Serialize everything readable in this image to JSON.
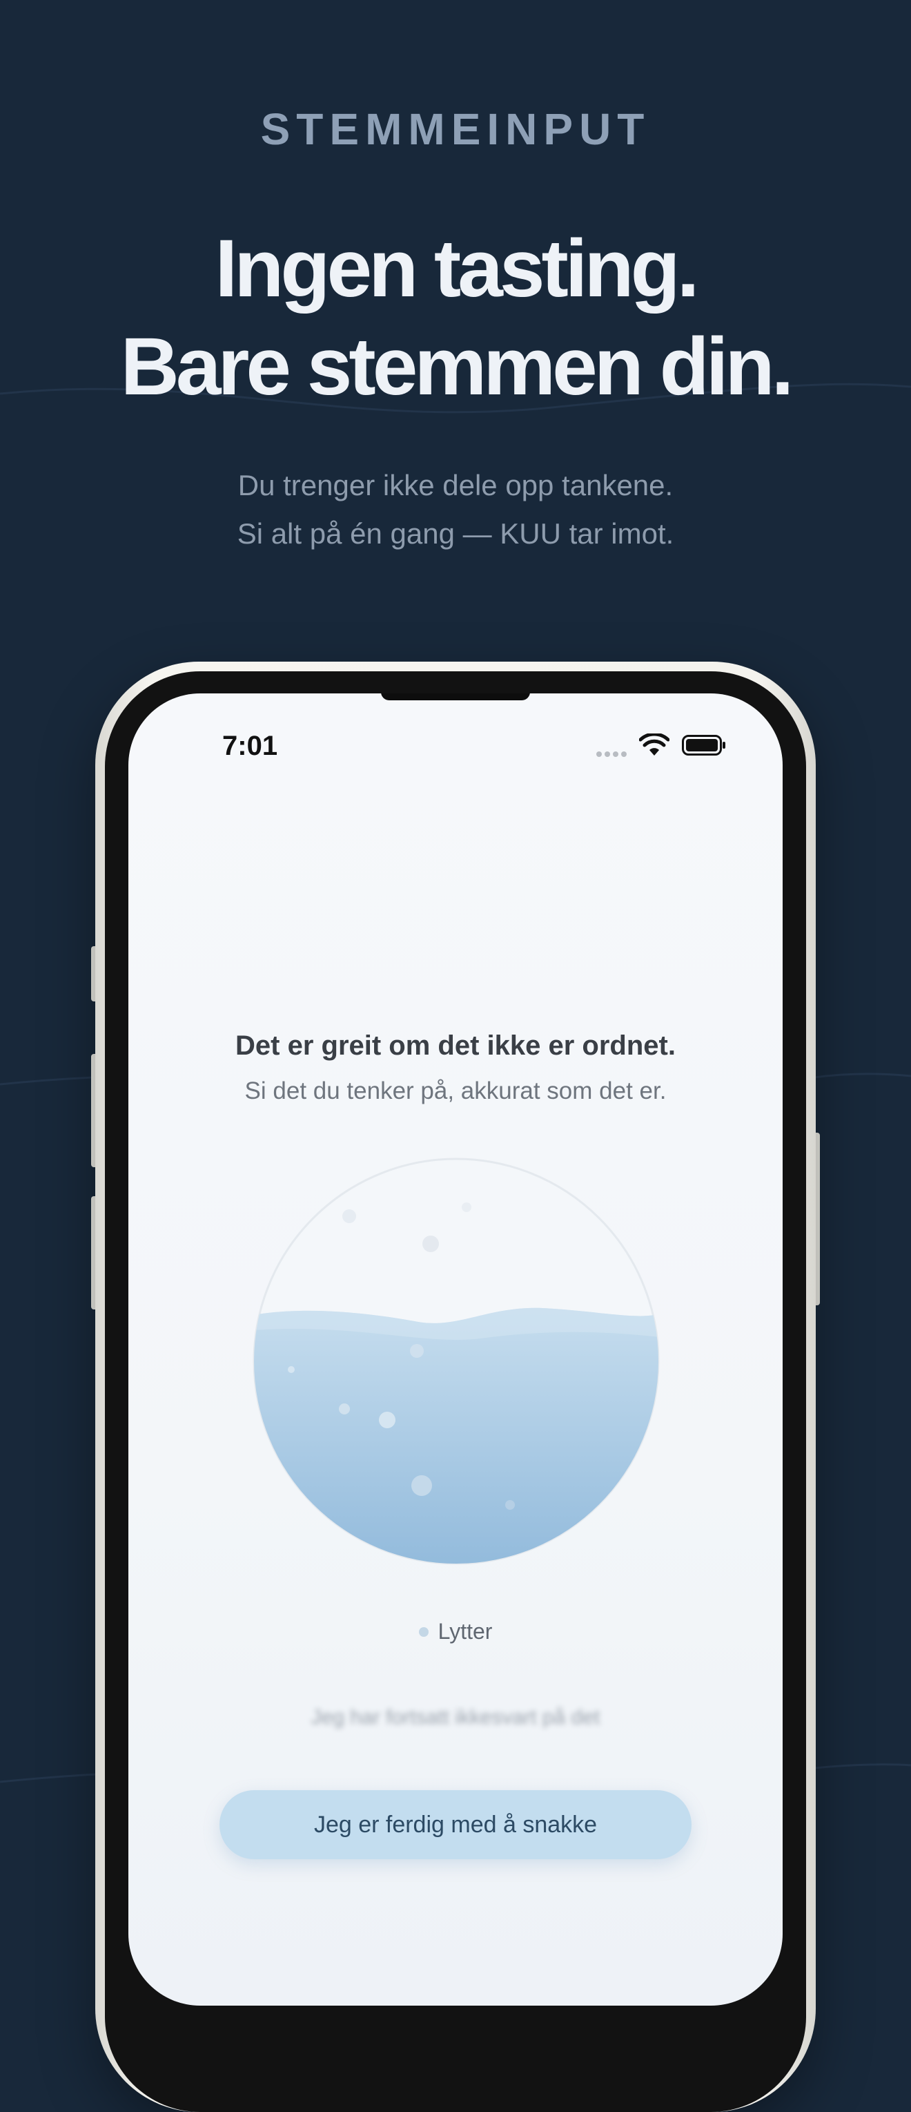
{
  "header": {
    "eyebrow": "STEMMEINPUT",
    "headline_line1": "Ingen tasting.",
    "headline_line2": "Bare stemmen din.",
    "subtitle_line1": "Du trenger ikke dele opp tankene.",
    "subtitle_line2": "Si alt på én gang — KUU tar imot."
  },
  "status_bar": {
    "time": "7:01",
    "wifi_icon": "wifi-icon",
    "battery_icon": "battery-icon",
    "signal_icon": "signal-dots-icon"
  },
  "screen": {
    "prompt_title": "Det er greit om det ikke er ordnet.",
    "prompt_subtitle": "Si det du tenker på, akkurat som det er.",
    "status_label": "Lytter",
    "transcript_text": "Jeg har fortsatt ikkesvart på det",
    "done_button_label": "Jeg er ferdig med å snakke"
  },
  "colors": {
    "background": "#18283a",
    "eyebrow": "#8ea0b6",
    "headline": "#eef2f7",
    "water_top": "#b9d5ea",
    "water_bottom": "#94bcdd",
    "button": "#c3ddef"
  }
}
